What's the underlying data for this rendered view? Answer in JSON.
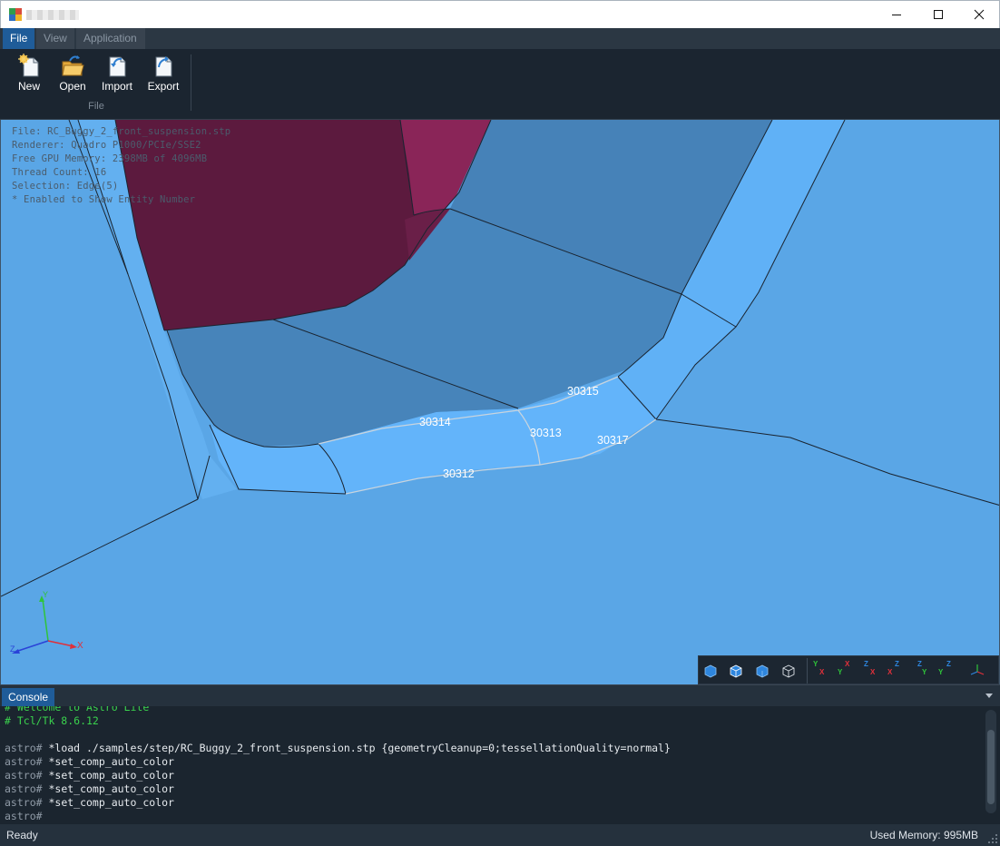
{
  "window": {
    "minimize_icon": "minimize-icon",
    "maximize_icon": "maximize-icon",
    "close_icon": "close-icon"
  },
  "menu": {
    "items": [
      {
        "label": "File",
        "active": true
      },
      {
        "label": "View",
        "active": false
      },
      {
        "label": "Application",
        "active": false
      }
    ]
  },
  "ribbon": {
    "group_label": "File",
    "buttons": [
      {
        "label": "New",
        "icon": "new-document-icon"
      },
      {
        "label": "Open",
        "icon": "open-folder-icon"
      },
      {
        "label": "Import",
        "icon": "import-icon"
      },
      {
        "label": "Export",
        "icon": "export-icon"
      }
    ]
  },
  "viewport": {
    "info_lines": [
      "File: RC_Buggy_2_front_suspension.stp",
      "Renderer: Quadro P1000/PCIe/SSE2",
      "Free GPU Memory: 2398MB of 4096MB",
      "Thread Count: 16",
      "Selection: Edge(5)",
      "* Enabled to Show Entity Number"
    ],
    "edge_labels": [
      "30315",
      "30314",
      "30313",
      "30317",
      "30312"
    ],
    "triad": {
      "x": "X",
      "y": "Y",
      "z": "Z"
    },
    "colors": {
      "background_face": "#5aa6e6",
      "dark_face": "#4482b8",
      "fillet_face": "#60b1f6",
      "magenta_face": "#5c1a3e",
      "magenta_light": "#8a2558"
    }
  },
  "view_toolbar": {
    "shading_buttons": [
      "shaded-icon",
      "shaded-edges-icon",
      "hidden-line-icon",
      "wireframe-icon"
    ],
    "view_buttons": [
      {
        "name": "view-front",
        "axes": [
          "Y",
          "X"
        ]
      },
      {
        "name": "view-back",
        "axes": [
          "Y",
          "X"
        ]
      },
      {
        "name": "view-top",
        "axes": [
          "Z",
          "X"
        ]
      },
      {
        "name": "view-bottom",
        "axes": [
          "Z",
          "X"
        ]
      },
      {
        "name": "view-left",
        "axes": [
          "Z",
          "Y"
        ]
      },
      {
        "name": "view-right",
        "axes": [
          "Z",
          "Y"
        ]
      },
      {
        "name": "view-iso",
        "axes": [
          "iso"
        ]
      }
    ]
  },
  "console": {
    "tab_label": "Console",
    "lines": [
      {
        "type": "comment",
        "text": "# Welcome to Astro Lite"
      },
      {
        "type": "comment",
        "text": "# Tcl/Tk 8.6.12"
      },
      {
        "type": "blank",
        "text": ""
      },
      {
        "type": "cmd",
        "prompt": "astro#",
        "text": " *load ./samples/step/RC_Buggy_2_front_suspension.stp {geometryCleanup=0;tessellationQuality=normal}"
      },
      {
        "type": "cmd",
        "prompt": "astro#",
        "text": " *set_comp_auto_color"
      },
      {
        "type": "cmd",
        "prompt": "astro#",
        "text": " *set_comp_auto_color"
      },
      {
        "type": "cmd",
        "prompt": "astro#",
        "text": " *set_comp_auto_color"
      },
      {
        "type": "cmd",
        "prompt": "astro#",
        "text": " *set_comp_auto_color"
      },
      {
        "type": "cmd",
        "prompt": "astro#",
        "text": ""
      }
    ]
  },
  "status": {
    "left": "Ready",
    "right": "Used Memory: 995MB"
  }
}
